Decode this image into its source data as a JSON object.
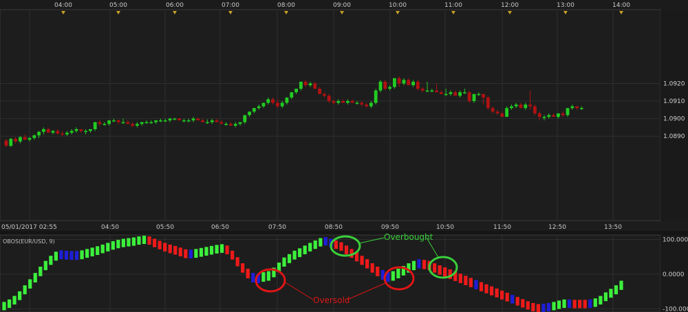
{
  "chart_data": [
    {
      "type": "candlestick",
      "symbol_pair": "EUR/USD",
      "top_time_ticks": [
        "04:00",
        "05:00",
        "06:00",
        "07:00",
        "08:00",
        "09:00",
        "10:00",
        "11:00",
        "12:00",
        "13:00",
        "14:00"
      ],
      "x_ticks": [
        "05/01/2017 02:55",
        "04:50",
        "05:50",
        "06:50",
        "07:50",
        "08:50",
        "09:50",
        "10:50",
        "11:50",
        "12:50",
        "13:50"
      ],
      "y_ticks": [
        "1.0920",
        "1.0910",
        "1.0900",
        "1.0890"
      ],
      "ylim": [
        1.0842,
        1.0962
      ],
      "grid": true,
      "colors": {
        "up": "#22cc22",
        "down": "#b01212",
        "background": "#1d1d1d",
        "grid": "#2c2c2c"
      },
      "candles": [
        [
          1.08875,
          1.08885,
          1.0884,
          1.08845
        ],
        [
          1.08845,
          1.0889,
          1.0884,
          1.08885
        ],
        [
          1.08885,
          1.08895,
          1.0886,
          1.0887
        ],
        [
          1.0887,
          1.089,
          1.0886,
          1.08895
        ],
        [
          1.08895,
          1.0891,
          1.0888,
          1.0888
        ],
        [
          1.0888,
          1.08895,
          1.0887,
          1.0889
        ],
        [
          1.0889,
          1.0891,
          1.0888,
          1.08905
        ],
        [
          1.08905,
          1.0893,
          1.0889,
          1.08925
        ],
        [
          1.08925,
          1.0895,
          1.0891,
          1.0894
        ],
        [
          1.0894,
          1.0895,
          1.0892,
          1.0892
        ],
        [
          1.0892,
          1.08935,
          1.0891,
          1.0893
        ],
        [
          1.0893,
          1.0894,
          1.0891,
          1.08915
        ],
        [
          1.08915,
          1.0893,
          1.089,
          1.0891
        ],
        [
          1.0891,
          1.0893,
          1.089,
          1.0892
        ],
        [
          1.0892,
          1.0894,
          1.0891,
          1.0893
        ],
        [
          1.0893,
          1.0895,
          1.0892,
          1.0894
        ],
        [
          1.0894,
          1.0894,
          1.0892,
          1.0893
        ],
        [
          1.0893,
          1.0894,
          1.0891,
          1.0893
        ],
        [
          1.0893,
          1.0894,
          1.0892,
          1.0894
        ],
        [
          1.0894,
          1.0898,
          1.0893,
          1.0898
        ],
        [
          1.0898,
          1.0899,
          1.0896,
          1.0897
        ],
        [
          1.0897,
          1.0898,
          1.0896,
          1.0897
        ],
        [
          1.0897,
          1.0899,
          1.0896,
          1.0899
        ],
        [
          1.0899,
          1.09,
          1.0898,
          1.0899
        ],
        [
          1.0899,
          1.08995,
          1.0897,
          1.0898
        ],
        [
          1.0898,
          1.09,
          1.0897,
          1.0898
        ],
        [
          1.0898,
          1.0899,
          1.0897,
          1.0897
        ],
        [
          1.0897,
          1.0898,
          1.0895,
          1.0896
        ],
        [
          1.0896,
          1.0898,
          1.0895,
          1.0897
        ],
        [
          1.0897,
          1.0898,
          1.0896,
          1.0898
        ],
        [
          1.0898,
          1.0899,
          1.0897,
          1.0898
        ],
        [
          1.0898,
          1.0899,
          1.0897,
          1.0898
        ],
        [
          1.0898,
          1.0899,
          1.0897,
          1.0899
        ],
        [
          1.0899,
          1.09,
          1.0898,
          1.0899
        ],
        [
          1.0899,
          1.09,
          1.0898,
          1.0899
        ],
        [
          1.0899,
          1.09005,
          1.0898,
          1.09
        ],
        [
          1.09,
          1.09005,
          1.0899,
          1.09
        ],
        [
          1.09,
          1.09005,
          1.0899,
          1.0899
        ],
        [
          1.0899,
          1.09,
          1.0898,
          1.0899
        ],
        [
          1.0899,
          1.09,
          1.0898,
          1.0899
        ],
        [
          1.0899,
          1.0901,
          1.0898,
          1.09
        ],
        [
          1.09,
          1.09005,
          1.0899,
          1.0899
        ],
        [
          1.0899,
          1.09,
          1.0898,
          1.0898
        ],
        [
          1.0898,
          1.08995,
          1.0897,
          1.0898
        ],
        [
          1.0898,
          1.09,
          1.0897,
          1.0899
        ],
        [
          1.0899,
          1.09,
          1.0898,
          1.0898
        ],
        [
          1.0898,
          1.0899,
          1.0897,
          1.0897
        ],
        [
          1.0897,
          1.0898,
          1.0896,
          1.0897
        ],
        [
          1.0897,
          1.0898,
          1.0896,
          1.0896
        ],
        [
          1.0896,
          1.0898,
          1.0895,
          1.0897
        ],
        [
          1.0897,
          1.0898,
          1.0896,
          1.0898
        ],
        [
          1.0898,
          1.0902,
          1.0897,
          1.0902
        ],
        [
          1.0902,
          1.0904,
          1.0901,
          1.0904
        ],
        [
          1.0904,
          1.0906,
          1.0903,
          1.0906
        ],
        [
          1.0906,
          1.0908,
          1.0905,
          1.0907
        ],
        [
          1.0907,
          1.0909,
          1.0906,
          1.0909
        ],
        [
          1.0909,
          1.0912,
          1.0908,
          1.0911
        ],
        [
          1.0911,
          1.0912,
          1.0908,
          1.0909
        ],
        [
          1.0909,
          1.0911,
          1.0906,
          1.0907
        ],
        [
          1.0907,
          1.091,
          1.0906,
          1.0909
        ],
        [
          1.0909,
          1.0912,
          1.0908,
          1.0912
        ],
        [
          1.0912,
          1.0915,
          1.0911,
          1.0915
        ],
        [
          1.0915,
          1.0917,
          1.0914,
          1.0917
        ],
        [
          1.0917,
          1.0921,
          1.0916,
          1.0921
        ],
        [
          1.0921,
          1.0922,
          1.0918,
          1.0919
        ],
        [
          1.0919,
          1.0921,
          1.0918,
          1.092
        ],
        [
          1.092,
          1.0921,
          1.0917,
          1.0917
        ],
        [
          1.0917,
          1.0918,
          1.0914,
          1.0914
        ],
        [
          1.0914,
          1.0915,
          1.0912,
          1.0913
        ],
        [
          1.0913,
          1.0914,
          1.0909,
          1.091
        ],
        [
          1.091,
          1.0911,
          1.0908,
          1.0909
        ],
        [
          1.0909,
          1.0911,
          1.0908,
          1.091
        ],
        [
          1.091,
          1.0911,
          1.0909,
          1.0909
        ],
        [
          1.0909,
          1.0911,
          1.0908,
          1.091
        ],
        [
          1.091,
          1.0911,
          1.0909,
          1.0909
        ],
        [
          1.0909,
          1.091,
          1.0908,
          1.0909
        ],
        [
          1.0909,
          1.091,
          1.0907,
          1.0908
        ],
        [
          1.0908,
          1.0909,
          1.0906,
          1.0907
        ],
        [
          1.0907,
          1.091,
          1.0906,
          1.0909
        ],
        [
          1.0909,
          1.0917,
          1.0908,
          1.0916
        ],
        [
          1.0916,
          1.0922,
          1.0915,
          1.0921
        ],
        [
          1.0921,
          1.0922,
          1.0916,
          1.0917
        ],
        [
          1.0917,
          1.0919,
          1.0916,
          1.0918
        ],
        [
          1.0918,
          1.0923,
          1.0917,
          1.0923
        ],
        [
          1.0923,
          1.0924,
          1.0918,
          1.092
        ],
        [
          1.092,
          1.0923,
          1.0919,
          1.0922
        ],
        [
          1.0922,
          1.0923,
          1.0919,
          1.0919
        ],
        [
          1.0919,
          1.0922,
          1.0918,
          1.0921
        ],
        [
          1.0921,
          1.0922,
          1.0916,
          1.0917
        ],
        [
          1.0917,
          1.0918,
          1.0915,
          1.0916
        ],
        [
          1.0916,
          1.0921,
          1.0915,
          1.0916
        ],
        [
          1.0916,
          1.0917,
          1.0915,
          1.0916
        ],
        [
          1.0916,
          1.092,
          1.0915,
          1.0915
        ],
        [
          1.0915,
          1.0916,
          1.0914,
          1.0914
        ],
        [
          1.0914,
          1.0917,
          1.0913,
          1.0914
        ],
        [
          1.0914,
          1.0916,
          1.0913,
          1.0915
        ],
        [
          1.0915,
          1.0916,
          1.0913,
          1.0913
        ],
        [
          1.0913,
          1.0916,
          1.0912,
          1.0915
        ],
        [
          1.0915,
          1.0917,
          1.0914,
          1.0915
        ],
        [
          1.0915,
          1.0916,
          1.0909,
          1.091
        ],
        [
          1.091,
          1.0914,
          1.0909,
          1.0914
        ],
        [
          1.0914,
          1.0915,
          1.0913,
          1.0914
        ],
        [
          1.0914,
          1.0914,
          1.0908,
          1.0912
        ],
        [
          1.0912,
          1.0913,
          1.0905,
          1.0906
        ],
        [
          1.0906,
          1.0907,
          1.0903,
          1.0904
        ],
        [
          1.0904,
          1.0905,
          1.0902,
          1.0903
        ],
        [
          1.0903,
          1.0904,
          1.0901,
          1.0901
        ],
        [
          1.0901,
          1.0907,
          1.0901,
          1.0906
        ],
        [
          1.0906,
          1.0908,
          1.0905,
          1.0907
        ],
        [
          1.0907,
          1.0909,
          1.0906,
          1.0908
        ],
        [
          1.0908,
          1.0909,
          1.0906,
          1.0906
        ],
        [
          1.0906,
          1.0909,
          1.0905,
          1.0908
        ],
        [
          1.0908,
          1.0916,
          1.0905,
          1.0907
        ],
        [
          1.0907,
          1.0908,
          1.0902,
          1.0903
        ],
        [
          1.0903,
          1.0904,
          1.0899,
          1.0901
        ],
        [
          1.0901,
          1.0902,
          1.0899,
          1.0901
        ],
        [
          1.0901,
          1.0903,
          1.09,
          1.0902
        ],
        [
          1.0902,
          1.0903,
          1.0901,
          1.0901
        ],
        [
          1.0901,
          1.0903,
          1.09,
          1.0903
        ],
        [
          1.0903,
          1.0904,
          1.0901,
          1.0902
        ],
        [
          1.0902,
          1.0906,
          1.0901,
          1.0906
        ],
        [
          1.0906,
          1.0908,
          1.0905,
          1.0907
        ],
        [
          1.0907,
          1.0907,
          1.0905,
          1.0906
        ],
        [
          1.0906,
          1.0907,
          1.0905,
          1.0906
        ]
      ]
    },
    {
      "type": "bar",
      "title": "OBOS(EUR/USD, 9)",
      "y_ticks": [
        "100.0000",
        "0.0000",
        "-100.0000"
      ],
      "ylim": [
        -105,
        105
      ],
      "colors": {
        "rising": "#3cf03c",
        "falling": "#ee1a1a",
        "neutral": "#1f1fd6"
      },
      "bars": [
        {
          "v": -92,
          "c": "g"
        },
        {
          "v": -85,
          "c": "g"
        },
        {
          "v": -75,
          "c": "g"
        },
        {
          "v": -62,
          "c": "g"
        },
        {
          "v": -45,
          "c": "g"
        },
        {
          "v": -28,
          "c": "g"
        },
        {
          "v": -10,
          "c": "g"
        },
        {
          "v": 8,
          "c": "g"
        },
        {
          "v": 25,
          "c": "g"
        },
        {
          "v": 40,
          "c": "g"
        },
        {
          "v": 52,
          "c": "g"
        },
        {
          "v": 56,
          "c": "b"
        },
        {
          "v": 55,
          "c": "b"
        },
        {
          "v": 54,
          "c": "b"
        },
        {
          "v": 54,
          "c": "b"
        },
        {
          "v": 56,
          "c": "g"
        },
        {
          "v": 60,
          "c": "g"
        },
        {
          "v": 64,
          "c": "g"
        },
        {
          "v": 68,
          "c": "g"
        },
        {
          "v": 73,
          "c": "g"
        },
        {
          "v": 78,
          "c": "g"
        },
        {
          "v": 83,
          "c": "g"
        },
        {
          "v": 87,
          "c": "g"
        },
        {
          "v": 90,
          "c": "g"
        },
        {
          "v": 92,
          "c": "g"
        },
        {
          "v": 94,
          "c": "g"
        },
        {
          "v": 97,
          "c": "g"
        },
        {
          "v": 99,
          "c": "g"
        },
        {
          "v": 97,
          "c": "r"
        },
        {
          "v": 90,
          "c": "r"
        },
        {
          "v": 84,
          "c": "r"
        },
        {
          "v": 78,
          "c": "r"
        },
        {
          "v": 73,
          "c": "r"
        },
        {
          "v": 69,
          "c": "r"
        },
        {
          "v": 64,
          "c": "r"
        },
        {
          "v": 59,
          "c": "r"
        },
        {
          "v": 58,
          "c": "b"
        },
        {
          "v": 60,
          "c": "g"
        },
        {
          "v": 63,
          "c": "g"
        },
        {
          "v": 66,
          "c": "g"
        },
        {
          "v": 69,
          "c": "g"
        },
        {
          "v": 72,
          "c": "g"
        },
        {
          "v": 74,
          "c": "g"
        },
        {
          "v": 70,
          "c": "r"
        },
        {
          "v": 55,
          "c": "r"
        },
        {
          "v": 36,
          "c": "r"
        },
        {
          "v": 18,
          "c": "r"
        },
        {
          "v": 2,
          "c": "r"
        },
        {
          "v": -10,
          "c": "b"
        },
        {
          "v": -12,
          "c": "b"
        },
        {
          "v": -8,
          "c": "g"
        },
        {
          "v": -5,
          "c": "g"
        },
        {
          "v": 5,
          "c": "g"
        },
        {
          "v": 20,
          "c": "g"
        },
        {
          "v": 35,
          "c": "g"
        },
        {
          "v": 45,
          "c": "g"
        },
        {
          "v": 55,
          "c": "g"
        },
        {
          "v": 62,
          "c": "g"
        },
        {
          "v": 70,
          "c": "g"
        },
        {
          "v": 78,
          "c": "g"
        },
        {
          "v": 85,
          "c": "g"
        },
        {
          "v": 92,
          "c": "g"
        },
        {
          "v": 95,
          "c": "b"
        },
        {
          "v": 90,
          "c": "b"
        },
        {
          "v": 85,
          "c": "r"
        },
        {
          "v": 80,
          "c": "r"
        },
        {
          "v": 70,
          "c": "r"
        },
        {
          "v": 60,
          "c": "r"
        },
        {
          "v": 50,
          "c": "r"
        },
        {
          "v": 40,
          "c": "r"
        },
        {
          "v": 30,
          "c": "r"
        },
        {
          "v": 18,
          "c": "r"
        },
        {
          "v": 8,
          "c": "r"
        },
        {
          "v": -2,
          "c": "b"
        },
        {
          "v": -8,
          "c": "b"
        },
        {
          "v": -5,
          "c": "g"
        },
        {
          "v": 2,
          "c": "g"
        },
        {
          "v": 10,
          "c": "g"
        },
        {
          "v": 18,
          "c": "g"
        },
        {
          "v": 25,
          "c": "g"
        },
        {
          "v": 30,
          "c": "b"
        },
        {
          "v": 28,
          "c": "r"
        },
        {
          "v": 25,
          "c": "r"
        },
        {
          "v": 18,
          "c": "r"
        },
        {
          "v": 12,
          "c": "r"
        },
        {
          "v": 6,
          "c": "r"
        },
        {
          "v": 0,
          "c": "r"
        },
        {
          "v": -6,
          "c": "r"
        },
        {
          "v": -12,
          "c": "r"
        },
        {
          "v": -18,
          "c": "r"
        },
        {
          "v": -24,
          "c": "r"
        },
        {
          "v": -30,
          "c": "b"
        },
        {
          "v": -36,
          "c": "r"
        },
        {
          "v": -42,
          "c": "r"
        },
        {
          "v": -48,
          "c": "r"
        },
        {
          "v": -54,
          "c": "r"
        },
        {
          "v": -60,
          "c": "r"
        },
        {
          "v": -66,
          "c": "r"
        },
        {
          "v": -72,
          "c": "b"
        },
        {
          "v": -78,
          "c": "r"
        },
        {
          "v": -84,
          "c": "r"
        },
        {
          "v": -90,
          "c": "r"
        },
        {
          "v": -95,
          "c": "r"
        },
        {
          "v": -98,
          "c": "r"
        },
        {
          "v": -97,
          "c": "b"
        },
        {
          "v": -95,
          "c": "b"
        },
        {
          "v": -92,
          "c": "g"
        },
        {
          "v": -88,
          "c": "g"
        },
        {
          "v": -85,
          "c": "g"
        },
        {
          "v": -85,
          "c": "b"
        },
        {
          "v": -86,
          "c": "r"
        },
        {
          "v": -86,
          "c": "r"
        },
        {
          "v": -86,
          "c": "r"
        },
        {
          "v": -85,
          "c": "b"
        },
        {
          "v": -82,
          "c": "g"
        },
        {
          "v": -75,
          "c": "g"
        },
        {
          "v": -65,
          "c": "g"
        },
        {
          "v": -55,
          "c": "g"
        },
        {
          "v": -45,
          "c": "g"
        },
        {
          "v": -32,
          "c": "g"
        }
      ],
      "annotations": [
        {
          "label": "Overbought",
          "color": "#3ad13a"
        },
        {
          "label": "Oversold",
          "color": "#e01515"
        }
      ]
    }
  ]
}
